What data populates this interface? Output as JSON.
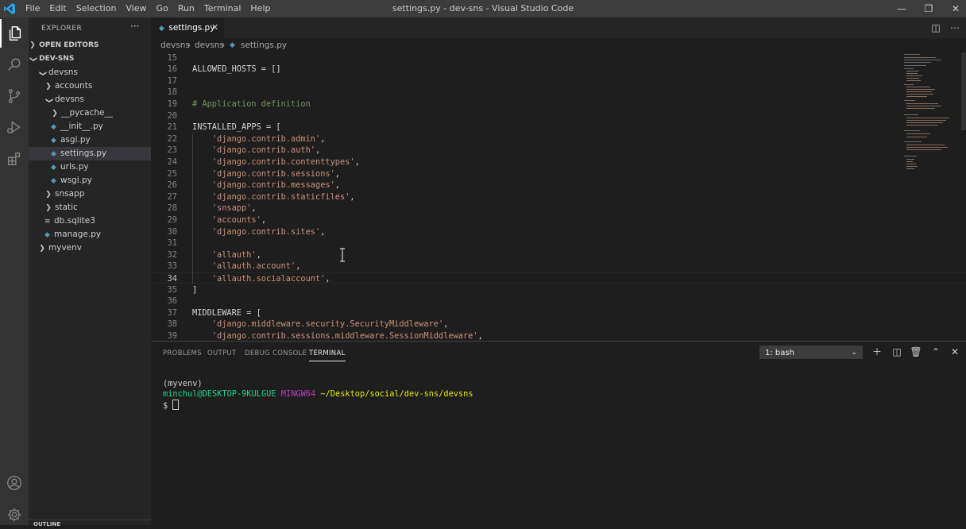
{
  "window": {
    "title": "settings.py - dev-sns - Visual Studio Code"
  },
  "menu": [
    "File",
    "Edit",
    "Selection",
    "View",
    "Go",
    "Run",
    "Terminal",
    "Help"
  ],
  "sidebar": {
    "title": "EXPLORER",
    "more": "···",
    "open_editors": "OPEN EDITORS",
    "workspace": "DEV-SNS",
    "items": [
      {
        "label": "devsns",
        "indent": 1,
        "kind": "folder-open"
      },
      {
        "label": "accounts",
        "indent": 2,
        "kind": "folder"
      },
      {
        "label": "devsns",
        "indent": 2,
        "kind": "folder-open"
      },
      {
        "label": "__pycache__",
        "indent": 3,
        "kind": "folder"
      },
      {
        "label": "__init__.py",
        "indent": 3,
        "kind": "py"
      },
      {
        "label": "asgi.py",
        "indent": 3,
        "kind": "py"
      },
      {
        "label": "settings.py",
        "indent": 3,
        "kind": "py",
        "selected": true
      },
      {
        "label": "urls.py",
        "indent": 3,
        "kind": "py"
      },
      {
        "label": "wsgi.py",
        "indent": 3,
        "kind": "py"
      },
      {
        "label": "snsapp",
        "indent": 2,
        "kind": "folder"
      },
      {
        "label": "static",
        "indent": 2,
        "kind": "folder"
      },
      {
        "label": "db.sqlite3",
        "indent": 2,
        "kind": "db"
      },
      {
        "label": "manage.py",
        "indent": 2,
        "kind": "py"
      },
      {
        "label": "myvenv",
        "indent": 1,
        "kind": "folder"
      }
    ],
    "outline": "OUTLINE"
  },
  "tab": {
    "label": "settings.py",
    "close": "✕"
  },
  "breadcrumb": [
    "devsns",
    "devsns",
    "settings.py"
  ],
  "editor": {
    "current_line": 34,
    "lines": [
      {
        "n": 15,
        "segs": []
      },
      {
        "n": 16,
        "segs": [
          {
            "t": "ALLOWED_HOSTS = []"
          }
        ]
      },
      {
        "n": 17,
        "segs": []
      },
      {
        "n": 18,
        "segs": []
      },
      {
        "n": 19,
        "segs": [
          {
            "t": "# Application definition",
            "c": "cmt"
          }
        ]
      },
      {
        "n": 20,
        "segs": []
      },
      {
        "n": 21,
        "segs": [
          {
            "t": "INSTALLED_APPS = ["
          }
        ]
      },
      {
        "n": 22,
        "segs": [
          {
            "t": "    "
          },
          {
            "t": "'django.contrib.admin'",
            "c": "str"
          },
          {
            "t": ","
          }
        ]
      },
      {
        "n": 23,
        "segs": [
          {
            "t": "    "
          },
          {
            "t": "'django.contrib.auth'",
            "c": "str"
          },
          {
            "t": ","
          }
        ]
      },
      {
        "n": 24,
        "segs": [
          {
            "t": "    "
          },
          {
            "t": "'django.contrib.contenttypes'",
            "c": "str"
          },
          {
            "t": ","
          }
        ]
      },
      {
        "n": 25,
        "segs": [
          {
            "t": "    "
          },
          {
            "t": "'django.contrib.sessions'",
            "c": "str"
          },
          {
            "t": ","
          }
        ]
      },
      {
        "n": 26,
        "segs": [
          {
            "t": "    "
          },
          {
            "t": "'django.contrib.messages'",
            "c": "str"
          },
          {
            "t": ","
          }
        ]
      },
      {
        "n": 27,
        "segs": [
          {
            "t": "    "
          },
          {
            "t": "'django.contrib.staticfiles'",
            "c": "str"
          },
          {
            "t": ","
          }
        ]
      },
      {
        "n": 28,
        "segs": [
          {
            "t": "    "
          },
          {
            "t": "'snsapp'",
            "c": "str"
          },
          {
            "t": ","
          }
        ]
      },
      {
        "n": 29,
        "segs": [
          {
            "t": "    "
          },
          {
            "t": "'accounts'",
            "c": "str"
          },
          {
            "t": ","
          }
        ]
      },
      {
        "n": 30,
        "segs": [
          {
            "t": "    "
          },
          {
            "t": "'django.contrib.sites'",
            "c": "str"
          },
          {
            "t": ","
          }
        ]
      },
      {
        "n": 31,
        "segs": []
      },
      {
        "n": 32,
        "segs": [
          {
            "t": "    "
          },
          {
            "t": "'allauth'",
            "c": "str"
          },
          {
            "t": ","
          }
        ]
      },
      {
        "n": 33,
        "segs": [
          {
            "t": "    "
          },
          {
            "t": "'allauth.account'",
            "c": "str"
          },
          {
            "t": ","
          }
        ]
      },
      {
        "n": 34,
        "segs": [
          {
            "t": "    "
          },
          {
            "t": "'allauth.socialaccount'",
            "c": "str"
          },
          {
            "t": ","
          }
        ]
      },
      {
        "n": 35,
        "segs": [
          {
            "t": "]"
          }
        ]
      },
      {
        "n": 36,
        "segs": []
      },
      {
        "n": 37,
        "segs": [
          {
            "t": "MIDDLEWARE = ["
          }
        ]
      },
      {
        "n": 38,
        "segs": [
          {
            "t": "    "
          },
          {
            "t": "'django.middleware.security.SecurityMiddleware'",
            "c": "str"
          },
          {
            "t": ","
          }
        ]
      },
      {
        "n": 39,
        "segs": [
          {
            "t": "    "
          },
          {
            "t": "'django.contrib.sessions.middleware.SessionMiddleware'",
            "c": "str"
          },
          {
            "t": ","
          }
        ]
      }
    ]
  },
  "panel": {
    "tabs": [
      "PROBLEMS",
      "OUTPUT",
      "DEBUG CONSOLE",
      "TERMINAL"
    ],
    "active_tab": "TERMINAL",
    "terminal_select": "1: bash",
    "terminal": {
      "venv": "(myvenv)",
      "user": "minchul@DESKTOP-9KULGUE",
      "shell": "MINGW64",
      "path": "~/Desktop/social/dev-sns/devsns",
      "prompt": "$"
    }
  },
  "colors": {
    "string": "#ce9178",
    "comment": "#6a9955",
    "accent": "#007acc"
  }
}
